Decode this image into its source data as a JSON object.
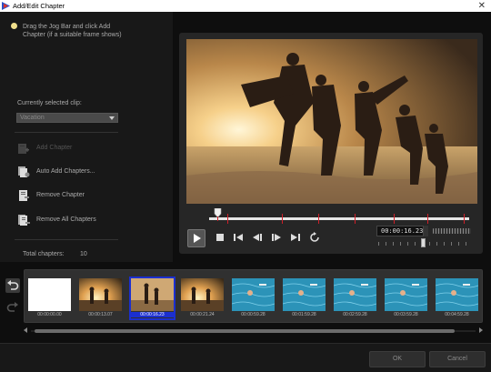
{
  "window": {
    "title": "Add/Edit Chapter"
  },
  "hint": {
    "text": "Drag the Jog Bar and click Add Chapter (if a suitable frame shows)"
  },
  "clip": {
    "label": "Currently selected clip:",
    "selected": "Vacation"
  },
  "actions": {
    "add_chapter": "Add Chapter",
    "auto_add": "Auto Add Chapters...",
    "remove_chapter": "Remove Chapter",
    "remove_all": "Remove All Chapters"
  },
  "total": {
    "label": "Total chapters:",
    "count": "10"
  },
  "player": {
    "timecode": "00:00:16.23",
    "chapter_markers": [
      0.07,
      0.28,
      0.42,
      0.56,
      0.71,
      0.84,
      0.98
    ],
    "playhead_position": 0.03,
    "zoom_position": 0.49
  },
  "icons": {
    "hint": "lightbulb-icon",
    "add_chapter": "add-chapter-icon",
    "auto_add": "auto-add-chapters-icon",
    "remove_chapter": "remove-chapter-icon",
    "remove_all": "remove-all-chapters-icon",
    "undo": "undo-icon",
    "redo": "redo-icon"
  },
  "frames": [
    {
      "timecode": "00:00:00.00",
      "scene": "blank",
      "selected": false
    },
    {
      "timecode": "00:00:13.07",
      "scene": "sunset",
      "selected": false
    },
    {
      "timecode": "00:00:16.23",
      "scene": "beach",
      "selected": true
    },
    {
      "timecode": "00:00:21.24",
      "scene": "sunset",
      "selected": false
    },
    {
      "timecode": "00:00:59.28",
      "scene": "pool",
      "selected": false
    },
    {
      "timecode": "00:01:59.28",
      "scene": "pool",
      "selected": false
    },
    {
      "timecode": "00:02:59.28",
      "scene": "pool",
      "selected": false
    },
    {
      "timecode": "00:03:59.28",
      "scene": "pool",
      "selected": false
    },
    {
      "timecode": "00:04:59.28",
      "scene": "pool",
      "selected": false
    }
  ],
  "buttons": {
    "ok": "OK",
    "cancel": "Cancel"
  },
  "colors": {
    "accent": "#1b2fd0",
    "marker": "#d0202a"
  }
}
